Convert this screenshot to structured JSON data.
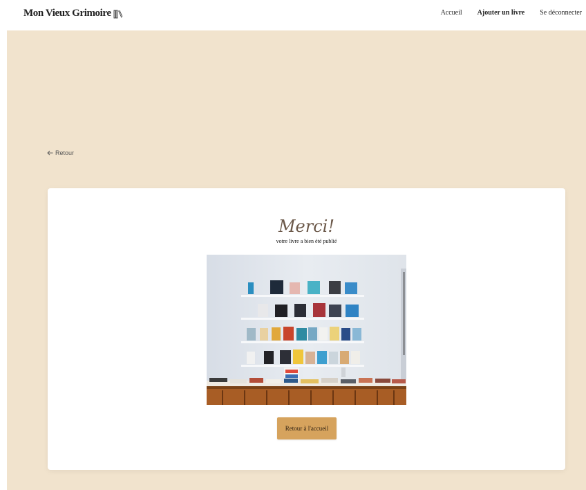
{
  "header": {
    "logo_text": "Mon Vieux Grimoire",
    "nav": [
      {
        "label": "Accueil"
      },
      {
        "label": "Ajouter un livre"
      },
      {
        "label": "Se déconnecter"
      }
    ]
  },
  "main": {
    "back_label": "Retour"
  },
  "card": {
    "title": "Merci!",
    "subtitle": "votre livre a bien été publié",
    "button_label": "Retour à l'accueil"
  },
  "colors": {
    "background": "#f1e3cd",
    "button": "#d6a35d",
    "title": "#6b5849"
  }
}
